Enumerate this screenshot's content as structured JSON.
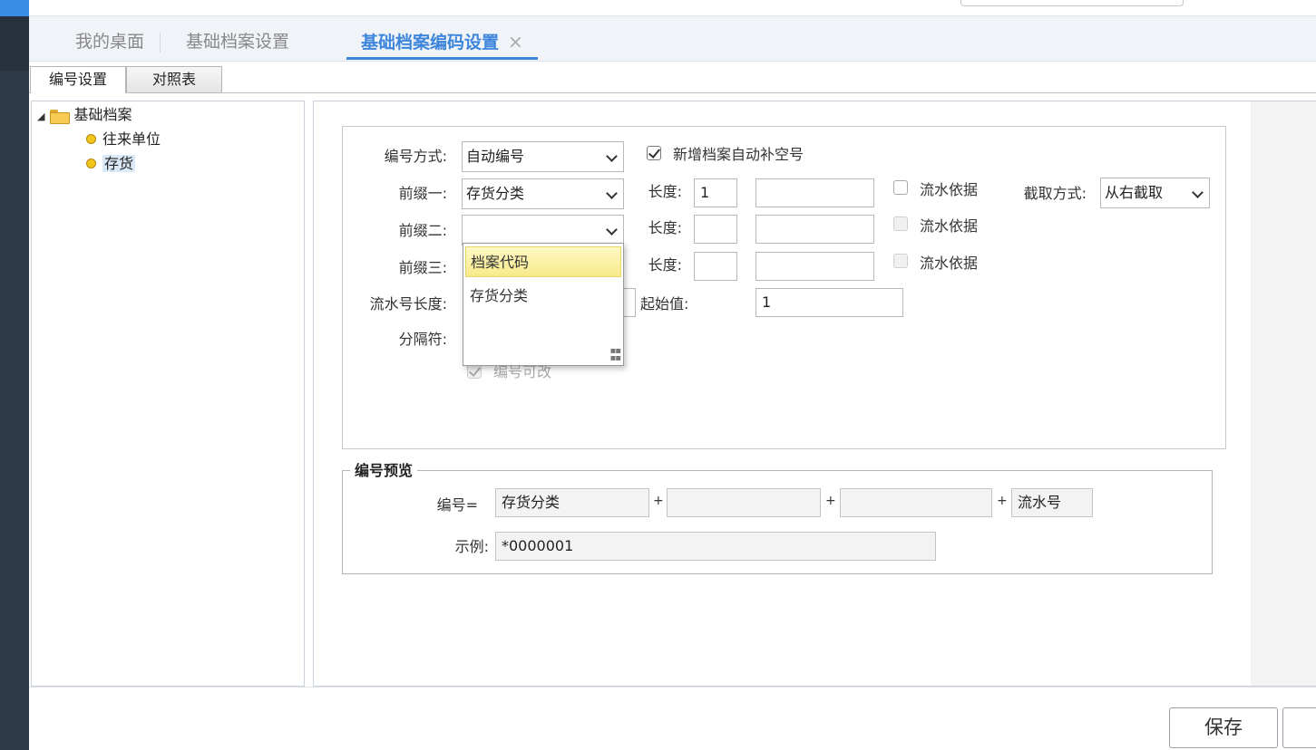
{
  "tabs": [
    {
      "label": "我的桌面"
    },
    {
      "label": "基础档案设置"
    },
    {
      "label": "基础档案编码设置",
      "close": "×"
    }
  ],
  "subtabs": [
    {
      "label": "编号设置"
    },
    {
      "label": "对照表"
    }
  ],
  "tree": {
    "root": "基础档案",
    "items": [
      "往来单位",
      "存货"
    ]
  },
  "form": {
    "mode_label": "编号方式:",
    "mode_value": "自动编号",
    "auto_fill_label": "新增档案自动补空号",
    "prefix1_label": "前缀一:",
    "prefix1_value": "存货分类",
    "prefix2_label": "前缀二:",
    "prefix2_value": "",
    "prefix3_label": "前缀三:",
    "length_label": "长度:",
    "length1_value": "1",
    "serial_basis_label": "流水依据",
    "cut_mode_label": "截取方式:",
    "cut_mode_value": "从右截取",
    "serial_length_label": "流水号长度:",
    "start_value_label": "起始值:",
    "start_value": "1",
    "separator_label": "分隔符:",
    "editable_label": "编号可改"
  },
  "dropdown": {
    "options": [
      "档案代码",
      "存货分类"
    ]
  },
  "preview": {
    "title": "编号预览",
    "code_label": "编号=",
    "part1": "存货分类",
    "part2": "",
    "part3": "",
    "part4": "流水号",
    "plus": "+",
    "example_label": "示例:",
    "example_value": "*0000001"
  },
  "footer": {
    "save_label": "保存"
  },
  "colors": {
    "accent": "#3d86db",
    "rail": "#2f3a48",
    "highlight": "#f8ea8a"
  }
}
